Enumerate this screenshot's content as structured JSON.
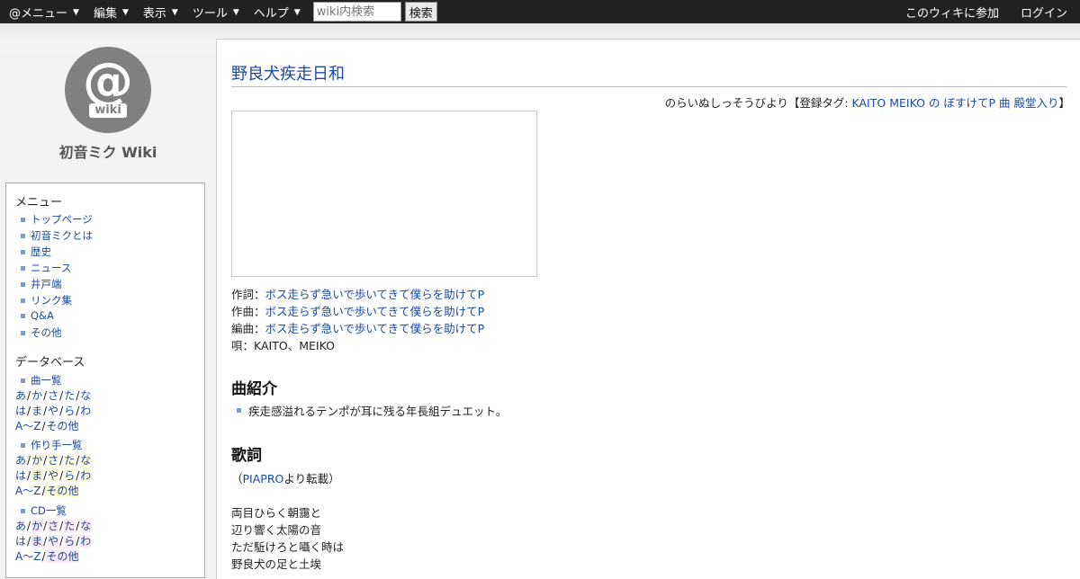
{
  "topbar": {
    "menus": [
      "@メニュー",
      "編集",
      "表示",
      "ツール",
      "ヘルプ"
    ],
    "search_placeholder": "wiki内検索",
    "search_button": "検索",
    "join_link": "このウィキに参加",
    "login_link": "ログイン"
  },
  "sidebar": {
    "logo_at": "@",
    "logo_text": "wiki",
    "site_title": "初音ミク Wiki",
    "menu_heading": "メニュー",
    "menu_items": [
      "トップページ",
      "初音ミクとは",
      "歴史",
      "ニュース",
      "井戸端",
      "リンク集",
      "Q&A",
      "その他"
    ],
    "db_heading": "データベース",
    "db_sections": [
      {
        "label": "曲一覧"
      },
      {
        "label": "作り手一覧"
      },
      {
        "label": "CD一覧"
      }
    ],
    "kana_row1": [
      "あ",
      "か",
      "さ",
      "た",
      "な"
    ],
    "kana_row2": [
      "は",
      "ま",
      "や",
      "ら",
      "わ"
    ],
    "kana_row3": [
      "A～Z",
      "その他"
    ]
  },
  "page": {
    "title": "野良犬疾走日和",
    "reading_prefix": "のらいぬしっそうびより【登録タグ: ",
    "tags": [
      "KAITO",
      "MEIKO",
      "の",
      "ぼすけてP",
      "曲",
      "殿堂入り"
    ],
    "reading_suffix": "】",
    "lyrics_label": "作詞：",
    "music_label": "作曲：",
    "arrange_label": "編曲：",
    "vocal_label": "唄：",
    "author": "ボス走らず急いで歩いてきて僕らを助けてP",
    "vocal": "KAITO、MEIKO",
    "intro_heading": "曲紹介",
    "intro_text": "疾走感溢れるテンポが耳に残る年長組デュエット。",
    "lyrics_heading": "歌詞",
    "source_prefix": "（",
    "source_link": "PIAPRO",
    "source_suffix": "より転載）",
    "lyrics_lines": [
      "両目ひらく朝靄と",
      "辺り響く太陽の音",
      "ただ駈けろと囁く時は",
      "野良犬の足と土埃"
    ]
  },
  "colors": {
    "link": "#1a4aa0",
    "topbar": "#222222",
    "bullet": "#7a9ccc"
  }
}
